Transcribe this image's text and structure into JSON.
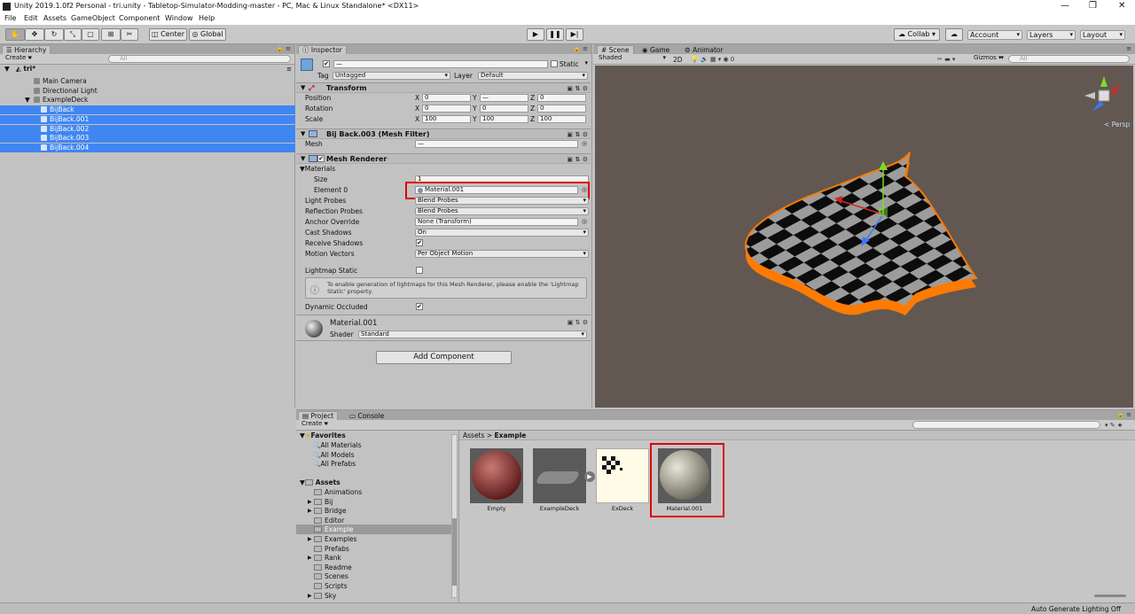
{
  "window": {
    "title": "Unity 2019.1.0f2 Personal - tri.unity - Tabletop-Simulator-Modding-master - PC, Mac & Linux Standalone* <DX11>",
    "controls": [
      "—",
      "❐",
      "✕"
    ]
  },
  "menu": [
    "File",
    "Edit",
    "Assets",
    "GameObject",
    "Component",
    "Window",
    "Help"
  ],
  "toolbar": {
    "tools": [
      "hand-icon",
      "move-icon",
      "rotate-icon",
      "scale-icon",
      "rect-icon",
      "transform-icon",
      "custom-tool-icon"
    ],
    "pivot_mode": "Center",
    "pivot_space": "Global",
    "collab": "Collab ▾",
    "account": "Account",
    "layers": "Layers",
    "layout": "Layout"
  },
  "hierarchy": {
    "tab": "Hierarchy",
    "create": "Create ▾",
    "search_placeholder": "All",
    "scene": "tri*",
    "items": [
      {
        "label": "Main Camera",
        "indent": 1,
        "selected": false
      },
      {
        "label": "Directional Light",
        "indent": 1,
        "selected": false
      },
      {
        "label": "ExampleDeck",
        "indent": 1,
        "selected": false
      },
      {
        "label": "BijBack",
        "indent": 2,
        "selected": true
      },
      {
        "label": "BijBack.001",
        "indent": 2,
        "selected": true
      },
      {
        "label": "BijBack.002",
        "indent": 2,
        "selected": true
      },
      {
        "label": "BijBack.003",
        "indent": 2,
        "selected": true
      },
      {
        "label": "BijBack.004",
        "indent": 2,
        "selected": true
      }
    ]
  },
  "inspector": {
    "tab": "Inspector",
    "name_value": "—",
    "static_label": "Static",
    "tag_label": "Tag",
    "tag_value": "Untagged",
    "layer_label": "Layer",
    "layer_value": "Default",
    "transform": {
      "header": "Transform",
      "position_label": "Position",
      "rotation_label": "Rotation",
      "scale_label": "Scale",
      "position": {
        "x": "0",
        "y": "—",
        "z": "0"
      },
      "rotation": {
        "x": "0",
        "y": "0",
        "z": "0"
      },
      "scale": {
        "x": "100",
        "y": "100",
        "z": "100"
      }
    },
    "mesh_filter": {
      "header": "Bij Back.003 (Mesh Filter)",
      "mesh_label": "Mesh",
      "mesh_value": "—"
    },
    "mesh_renderer": {
      "header": "Mesh Renderer",
      "materials_label": "Materials",
      "size_label": "Size",
      "size_value": "1",
      "element0_label": "Element 0",
      "element0_value": "Material.001",
      "light_probes_label": "Light Probes",
      "light_probes_value": "Blend Probes",
      "reflection_probes_label": "Reflection Probes",
      "reflection_probes_value": "Blend Probes",
      "anchor_override_label": "Anchor Override",
      "anchor_override_value": "None (Transform)",
      "cast_shadows_label": "Cast Shadows",
      "cast_shadows_value": "On",
      "receive_shadows_label": "Receive Shadows",
      "motion_vectors_label": "Motion Vectors",
      "motion_vectors_value": "Per Object Motion",
      "lightmap_static_label": "Lightmap Static",
      "info_text": "To enable generation of lightmaps for this Mesh Renderer, please enable the 'Lightmap Static' property.",
      "dynamic_occluded_label": "Dynamic Occluded"
    },
    "material": {
      "name": "Material.001",
      "shader_label": "Shader",
      "shader_value": "Standard"
    },
    "add_component": "Add Component"
  },
  "scene_view": {
    "tabs": [
      "Scene",
      "Game",
      "Animator"
    ],
    "shading": "Shaded",
    "mode_2d": "2D",
    "gizmos": "Gizmos ▾",
    "search_placeholder": "All",
    "persp_label": "< Persp",
    "background_color": "#625851",
    "outline_color": "#ff7a00"
  },
  "project": {
    "tabs": [
      "Project",
      "Console"
    ],
    "create": "Create ▾",
    "breadcrumb_root": "Assets",
    "breadcrumb_sep": ">",
    "breadcrumb_current": "Example",
    "favorites_label": "Favorites",
    "favorites": [
      "All Materials",
      "All Models",
      "All Prefabs"
    ],
    "assets_label": "Assets",
    "folders": [
      {
        "label": "Animations",
        "arrow": false,
        "selected": false
      },
      {
        "label": "Bij",
        "arrow": true,
        "selected": false
      },
      {
        "label": "Bridge",
        "arrow": true,
        "selected": false
      },
      {
        "label": "Editor",
        "arrow": false,
        "selected": false
      },
      {
        "label": "Example",
        "arrow": false,
        "selected": true
      },
      {
        "label": "Examples",
        "arrow": true,
        "selected": false
      },
      {
        "label": "Prefabs",
        "arrow": false,
        "selected": false
      },
      {
        "label": "Rank",
        "arrow": true,
        "selected": false
      },
      {
        "label": "Readme",
        "arrow": false,
        "selected": false
      },
      {
        "label": "Scenes",
        "arrow": false,
        "selected": false
      },
      {
        "label": "Scripts",
        "arrow": false,
        "selected": false
      },
      {
        "label": "Sky",
        "arrow": true,
        "selected": false
      }
    ],
    "assets": [
      "Empty",
      "ExampleDeck",
      "ExDeck",
      "Material.001"
    ],
    "status": "Auto Generate Lighting Off"
  }
}
